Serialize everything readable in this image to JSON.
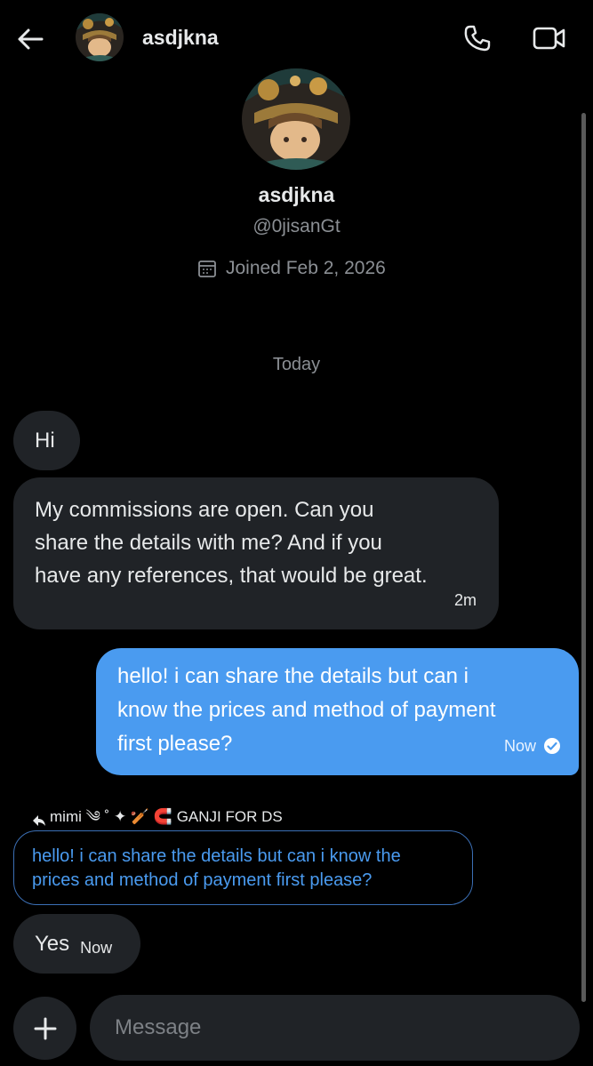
{
  "header": {
    "name": "asdjkna",
    "back_icon": "arrow-left-icon",
    "call_icon": "phone-icon",
    "video_icon": "video-camera-icon"
  },
  "profile": {
    "name": "asdjkna",
    "handle": "@0jisanGt",
    "joined": "Joined Feb 2, 2026",
    "joined_icon": "calendar-icon"
  },
  "conversation": {
    "day_label": "Today",
    "messages": [
      {
        "sender": "other",
        "text": "Hi",
        "time": ""
      },
      {
        "sender": "other",
        "lines": [
          "My commissions are open. Can you",
          "share the details with me? And if you",
          "have any references, that would be great."
        ],
        "time": "2m"
      },
      {
        "sender": "me",
        "lines": [
          "hello! i can share the details but can i",
          "know the prices and method of payment",
          "first please?"
        ],
        "time": "Now",
        "status_icon": "check-circle-icon"
      },
      {
        "sender": "other",
        "reply_to_label": "mimi ༄ ˚ ✦ 🏏 🧲 GANJI FOR DS",
        "reply_lines": [
          "hello! i can share the details but can i know the",
          "prices and method of payment first please?"
        ],
        "text": "Yes",
        "time": "Now"
      }
    ]
  },
  "composer": {
    "placeholder": "Message",
    "add_icon": "plus-icon"
  },
  "colors": {
    "background": "#000000",
    "incoming_bubble": "#202327",
    "outgoing_bubble": "#4a9bf0",
    "secondary_text": "#8b8f94"
  }
}
